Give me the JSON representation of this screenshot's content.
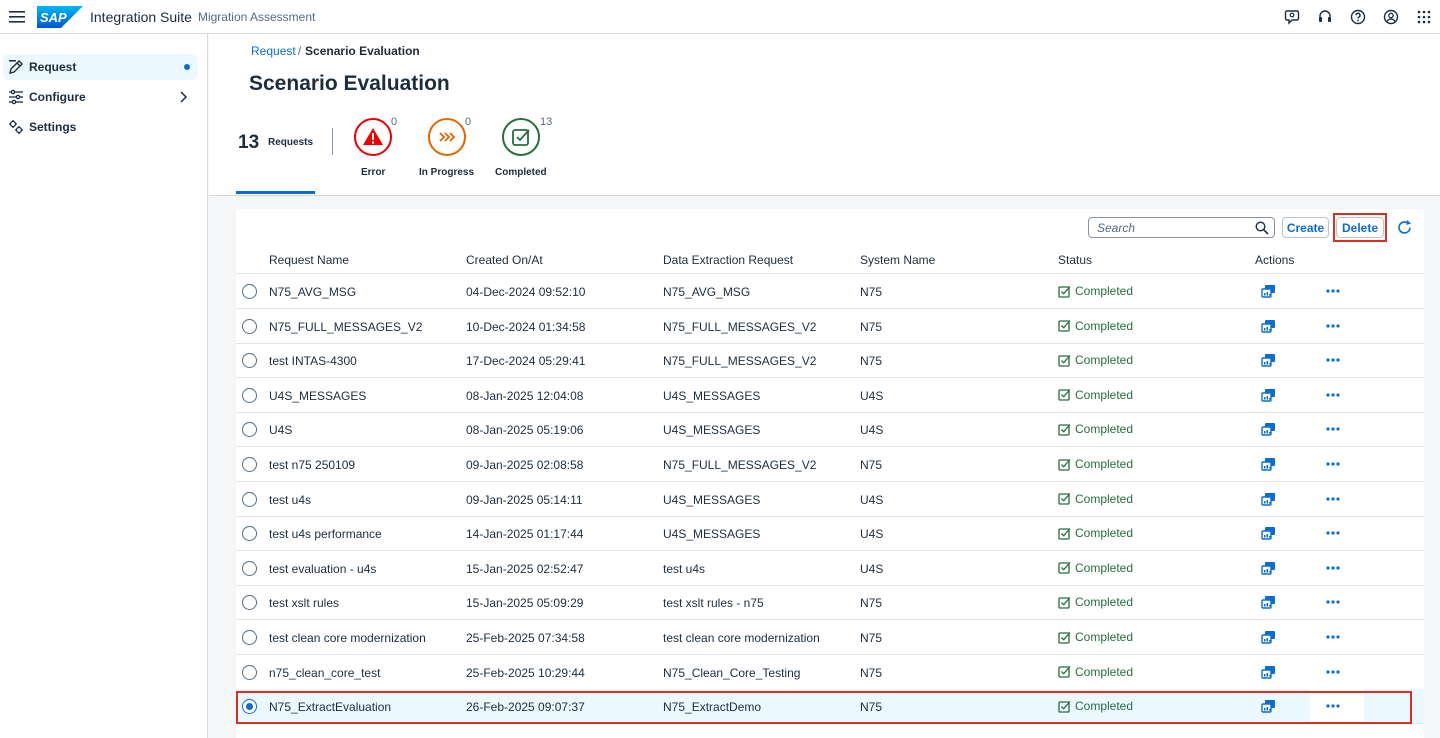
{
  "shell": {
    "logo": "SAP",
    "app_title": "Integration Suite",
    "app_subtitle": "Migration Assessment",
    "icons": [
      "menu-icon",
      "feedback-icon",
      "support-icon",
      "help-icon",
      "user-icon",
      "app-grid-icon"
    ]
  },
  "sidebar": {
    "items": [
      {
        "label": "Request",
        "icon": "edit-icon",
        "active": true
      },
      {
        "label": "Configure",
        "icon": "settings-sliders-icon",
        "has_chevron": true
      },
      {
        "label": "Settings",
        "icon": "gears-icon"
      }
    ]
  },
  "breadcrumb": {
    "link": "Request",
    "separator": "/",
    "current": "Scenario Evaluation"
  },
  "page_title": "Scenario Evaluation",
  "tabs": {
    "all": {
      "count": "13",
      "label": "Requests"
    },
    "error": {
      "count": "0",
      "label": "Error",
      "color": "#e00"
    },
    "in_progress": {
      "count": "0",
      "label": "In Progress",
      "color": "#e76500"
    },
    "completed": {
      "count": "13",
      "label": "Completed",
      "color": "#256f3a"
    }
  },
  "toolbar": {
    "search_placeholder": "Search",
    "create_label": "Create",
    "delete_label": "Delete"
  },
  "table": {
    "headers": [
      "Request Name",
      "Created On/At",
      "Data Extraction Request",
      "System Name",
      "Status",
      "Actions"
    ],
    "rows": [
      {
        "name": "N75_AVG_MSG",
        "created": "04-Dec-2024 09:52:10",
        "extraction": "N75_AVG_MSG",
        "system": "N75",
        "status": "Completed"
      },
      {
        "name": "N75_FULL_MESSAGES_V2",
        "created": "10-Dec-2024 01:34:58",
        "extraction": "N75_FULL_MESSAGES_V2",
        "system": "N75",
        "status": "Completed"
      },
      {
        "name": "test INTAS-4300",
        "created": "17-Dec-2024 05:29:41",
        "extraction": "N75_FULL_MESSAGES_V2",
        "system": "N75",
        "status": "Completed"
      },
      {
        "name": "U4S_MESSAGES",
        "created": "08-Jan-2025 12:04:08",
        "extraction": "U4S_MESSAGES",
        "system": "U4S",
        "status": "Completed"
      },
      {
        "name": "U4S",
        "created": "08-Jan-2025 05:19:06",
        "extraction": "U4S_MESSAGES",
        "system": "U4S",
        "status": "Completed"
      },
      {
        "name": "test n75 250109",
        "created": "09-Jan-2025 02:08:58",
        "extraction": "N75_FULL_MESSAGES_V2",
        "system": "N75",
        "status": "Completed"
      },
      {
        "name": "test u4s",
        "created": "09-Jan-2025 05:14:11",
        "extraction": "U4S_MESSAGES",
        "system": "U4S",
        "status": "Completed"
      },
      {
        "name": "test u4s performance",
        "created": "14-Jan-2025 01:17:44",
        "extraction": "U4S_MESSAGES",
        "system": "U4S",
        "status": "Completed"
      },
      {
        "name": "test evaluation - u4s",
        "created": "15-Jan-2025 02:52:47",
        "extraction": "test u4s",
        "system": "U4S",
        "status": "Completed"
      },
      {
        "name": "test xslt rules",
        "created": "15-Jan-2025 05:09:29",
        "extraction": "test xslt rules - n75",
        "system": "N75",
        "status": "Completed"
      },
      {
        "name": "test clean core modernization",
        "created": "25-Feb-2025 07:34:58",
        "extraction": "test clean core modernization",
        "system": "N75",
        "status": "Completed"
      },
      {
        "name": "n75_clean_core_test",
        "created": "25-Feb-2025 10:29:44",
        "extraction": "N75_Clean_Core_Testing",
        "system": "N75",
        "status": "Completed"
      },
      {
        "name": "N75_ExtractEvaluation",
        "created": "26-Feb-2025 09:07:37",
        "extraction": "N75_ExtractDemo",
        "system": "N75",
        "status": "Completed",
        "selected": true
      }
    ]
  },
  "colors": {
    "brand": "#0a6ed1",
    "success": "#256f3a",
    "highlight": "#d93025"
  }
}
